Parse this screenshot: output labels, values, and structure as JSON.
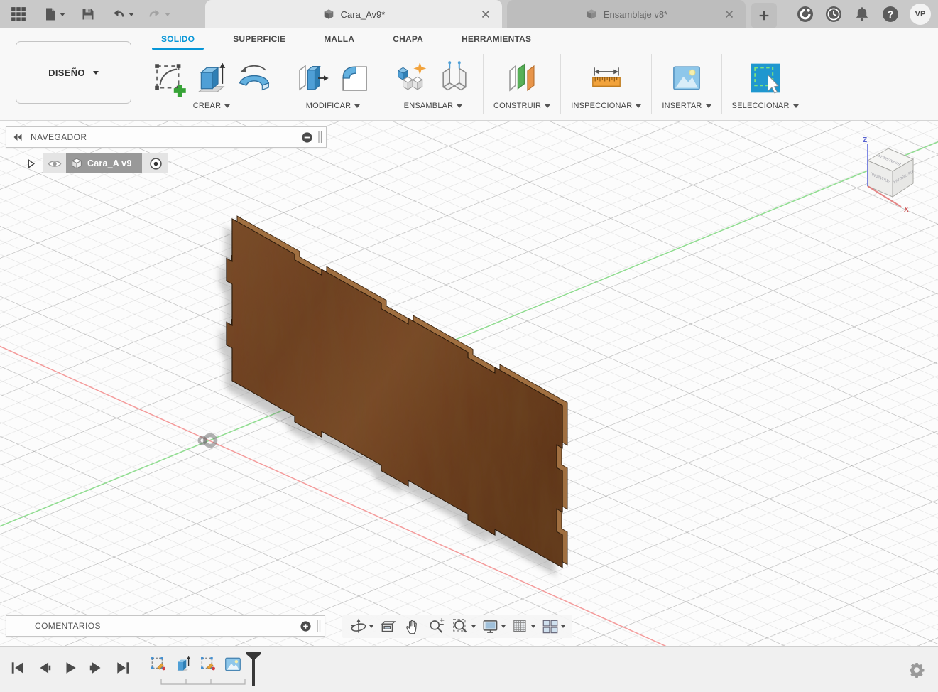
{
  "titlebar": {
    "documents": [
      {
        "title": "Cara_Av9*",
        "active": true
      },
      {
        "title": "Ensamblaje v8*",
        "active": false
      }
    ],
    "avatar_initials": "VP"
  },
  "ribbon": {
    "workspace_label": "DISEÑO",
    "tabs": [
      {
        "label": "SOLIDO",
        "active": true
      },
      {
        "label": "SUPERFICIE",
        "active": false
      },
      {
        "label": "MALLA",
        "active": false
      },
      {
        "label": "CHAPA",
        "active": false
      },
      {
        "label": "HERRAMIENTAS",
        "active": false
      }
    ],
    "groups": [
      {
        "label": "CREAR",
        "icons": [
          "create-sketch-icon",
          "extrude-icon",
          "revolve-icon"
        ]
      },
      {
        "label": "MODIFICAR",
        "icons": [
          "press-pull-icon",
          "fillet-icon"
        ]
      },
      {
        "label": "ENSAMBLAR",
        "icons": [
          "new-component-icon",
          "joint-icon"
        ]
      },
      {
        "label": "CONSTRUIR",
        "icons": [
          "construction-plane-icon"
        ]
      },
      {
        "label": "INSPECCIONAR",
        "icons": [
          "measure-icon"
        ]
      },
      {
        "label": "INSERTAR",
        "icons": [
          "insert-image-icon"
        ]
      },
      {
        "label": "SELECCIONAR",
        "icons": [
          "select-icon"
        ]
      }
    ]
  },
  "browser_panel": {
    "title": "NAVEGADOR",
    "component": {
      "name": "Cara_A v9",
      "selected": true,
      "visible": true
    }
  },
  "comments_panel": {
    "title": "COMENTARIOS"
  },
  "viewcube": {
    "faces": {
      "top": "SUPERIOR",
      "front": "FRONTAL",
      "right": "DERECHA"
    },
    "axes": {
      "z": "Z",
      "x": "X"
    }
  },
  "icons": {
    "help_glyph": "?"
  },
  "colors": {
    "accent_blue": "#0696d7",
    "titlebar_bg": "#c9c9c9",
    "active_tab_bg": "#ebebeb",
    "wood_base": "#7a4526",
    "wood_light": "#a06f40",
    "axis_red": "#f49b9b",
    "axis_green": "#8fdc8f",
    "selection_gray": "#999999",
    "star_orange": "#f2a33c"
  }
}
